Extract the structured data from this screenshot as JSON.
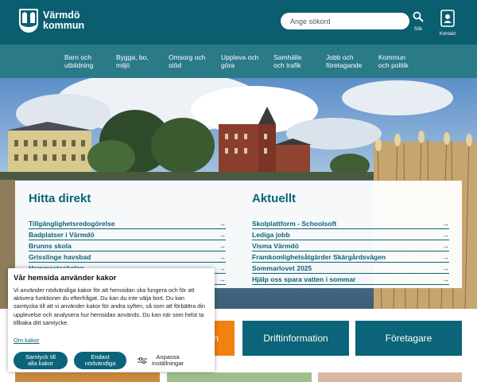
{
  "header": {
    "logo_line1": "Värmdö",
    "logo_line2": "kommun",
    "search_placeholder": "Ange sökord",
    "search_label": "Sök",
    "contact_label": "Kontakt",
    "bg": "#0a5e70"
  },
  "nav": {
    "items": [
      {
        "l1": "Barn och",
        "l2": "utbildning"
      },
      {
        "l1": "Bygga, bo,",
        "l2": "miljö"
      },
      {
        "l1": "Omsorg och",
        "l2": "stöd"
      },
      {
        "l1": "Uppleva och",
        "l2": "göra"
      },
      {
        "l1": "Samhälle",
        "l2": "och trafik"
      },
      {
        "l1": "Jobb och",
        "l2": "företagande"
      },
      {
        "l1": "Kommun",
        "l2": "och politik"
      }
    ]
  },
  "hitta": {
    "title": "Hitta direkt",
    "links": [
      "Tillgänglighetsredogörelse",
      "Badplatser i Värmdö",
      "Brunns skola",
      "Grisslinge havsbad",
      "Hemmestaskolan",
      ""
    ]
  },
  "aktuellt": {
    "title": "Aktuellt",
    "links": [
      "Skolplattform - Schoolsoft",
      "Lediga jobb",
      "Visma Värmdö",
      "Framkomlighetsåtgärder Skärgårdsvägen",
      "Sommarlovet 2025",
      "Hjälp oss spara vatten i sommar"
    ]
  },
  "tiles": {
    "first_visible": "n",
    "drift": "Driftinformation",
    "foretagare": "Företagare"
  },
  "cookie": {
    "title": "Vår hemsida använder kakor",
    "text": "Vi använder nödvändiga kakor för att hemsidan ska fungera och för att aktivera funktioner du efterfrågat. Du kan du inte välja bort. Du kan samtycka till att vi använder kakor för andra syften, så som att förbättra din upplevelse och analysera hur hemsidan används. Du kan när som helst ta tillbaka ditt samtycke.",
    "about_link": "Om kakor",
    "accept_l1": "Samtyck till",
    "accept_l2": "alla kakor",
    "necessary_l1": "Endast",
    "necessary_l2": "nödvändiga",
    "customize_l1": "Anpassa",
    "customize_l2": "inställningar"
  },
  "colors": {
    "primary": "#0b6479",
    "nav": "#2a7a88",
    "orange": "#f0820f"
  }
}
